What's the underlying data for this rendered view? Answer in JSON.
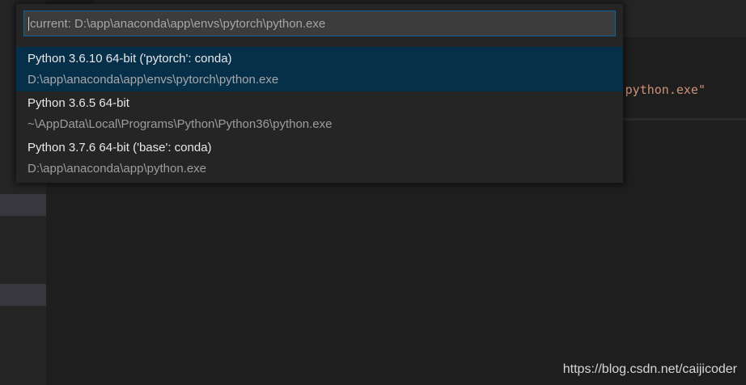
{
  "editor": {
    "visible_code_fragment": "python.exe\""
  },
  "quick_pick": {
    "input_placeholder": "current: D:\\app\\anaconda\\app\\envs\\pytorch\\python.exe",
    "items": [
      {
        "label": "Python 3.6.10 64-bit ('pytorch': conda)",
        "detail": "D:\\app\\anaconda\\app\\envs\\pytorch\\python.exe",
        "selected": true
      },
      {
        "label": "Python 3.6.5 64-bit",
        "detail": "~\\AppData\\Local\\Programs\\Python\\Python36\\python.exe",
        "selected": false
      },
      {
        "label": "Python 3.7.6 64-bit ('base': conda)",
        "detail": "D:\\app\\anaconda\\app\\python.exe",
        "selected": false
      }
    ]
  },
  "watermark": "https://blog.csdn.net/caijicoder",
  "colors": {
    "background": "#1e1e1e",
    "selection": "#062f4a",
    "focus_border": "#0e639c",
    "string": "#ce9178"
  }
}
